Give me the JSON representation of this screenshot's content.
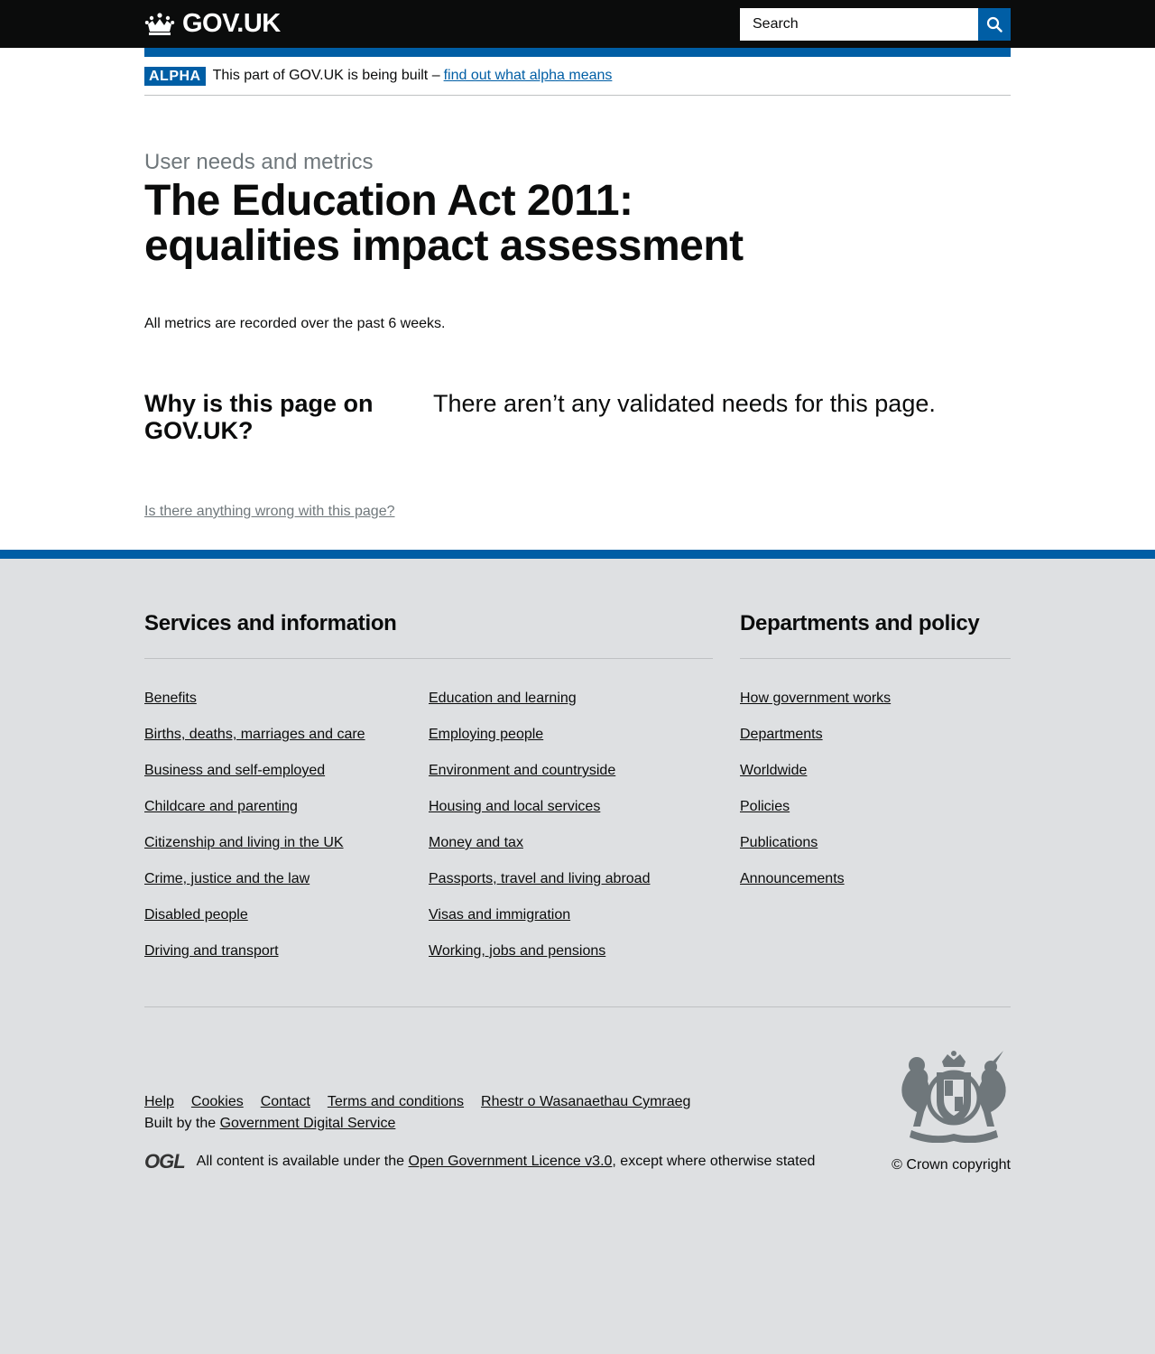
{
  "header": {
    "logo_text": "GOV.UK",
    "search_placeholder": "Search"
  },
  "phase_banner": {
    "tag": "ALPHA",
    "text": "This part of GOV.UK is being built –",
    "link": "find out what alpha means"
  },
  "page": {
    "caption": "User needs and metrics",
    "title": "The Education Act 2011: equalities impact assessment",
    "metrics_note": "All metrics are recorded over the past 6 weeks.",
    "needs_heading": "Why is this page on GOV.UK?",
    "needs_text": "There aren’t any validated needs for this page.",
    "wrong_link": "Is there anything wrong with this page?"
  },
  "footer": {
    "services_heading": "Services and information",
    "services_col1": [
      "Benefits",
      "Births, deaths, marriages and care",
      "Business and self-employed",
      "Childcare and parenting",
      "Citizenship and living in the UK",
      "Crime, justice and the law",
      "Disabled people",
      "Driving and transport"
    ],
    "services_col2": [
      "Education and learning",
      "Employing people",
      "Environment and countryside",
      "Housing and local services",
      "Money and tax",
      "Passports, travel and living abroad",
      "Visas and immigration",
      "Working, jobs and pensions"
    ],
    "departments_heading": "Departments and policy",
    "departments": [
      "How government works",
      "Departments",
      "Worldwide",
      "Policies",
      "Publications",
      "Announcements"
    ],
    "meta_links": [
      "Help",
      "Cookies",
      "Contact",
      "Terms and conditions",
      "Rhestr o Wasanaethau Cymraeg"
    ],
    "built_by_prefix": "Built by the",
    "built_by_link": "Government Digital Service",
    "ogl_logo": "OGL",
    "licence_prefix": "All content is available under the",
    "licence_link": "Open Government Licence v3.0",
    "licence_suffix": ", except where otherwise stated",
    "copyright": "© Crown copyright"
  },
  "colors": {
    "brand_blue": "#005ea5",
    "header_black": "#0b0c0c",
    "footer_grey": "#dee0e2",
    "secondary_text": "#6f777b"
  }
}
